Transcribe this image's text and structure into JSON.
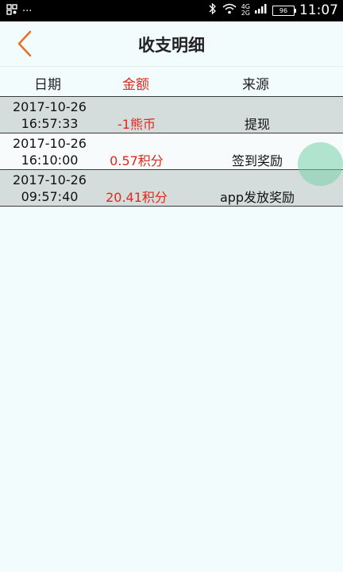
{
  "status_bar": {
    "left_icons": [
      "notification-icon",
      "more-dots"
    ],
    "more": "···",
    "network_top": "4G",
    "network_bottom": "2G",
    "battery": "96",
    "time": "11:07"
  },
  "header": {
    "title": "收支明细",
    "back_icon": "chevron-left-icon",
    "accent_color": "#e8722a"
  },
  "columns": {
    "date": "日期",
    "amount": "金额",
    "source": "来源"
  },
  "records": [
    {
      "date": "2017-10-26",
      "time": "16:57:33",
      "amount": "-1熊币",
      "source": "提现"
    },
    {
      "date": "2017-10-26",
      "time": "16:10:00",
      "amount": "0.57积分",
      "source": "签到奖励"
    },
    {
      "date": "2017-10-26",
      "time": "09:57:40",
      "amount": "20.41积分",
      "source": "app发放奖励"
    }
  ],
  "colors": {
    "amount": "#e0281c",
    "background": "#f3fcfd",
    "row_shaded": "#d5dcdc"
  }
}
